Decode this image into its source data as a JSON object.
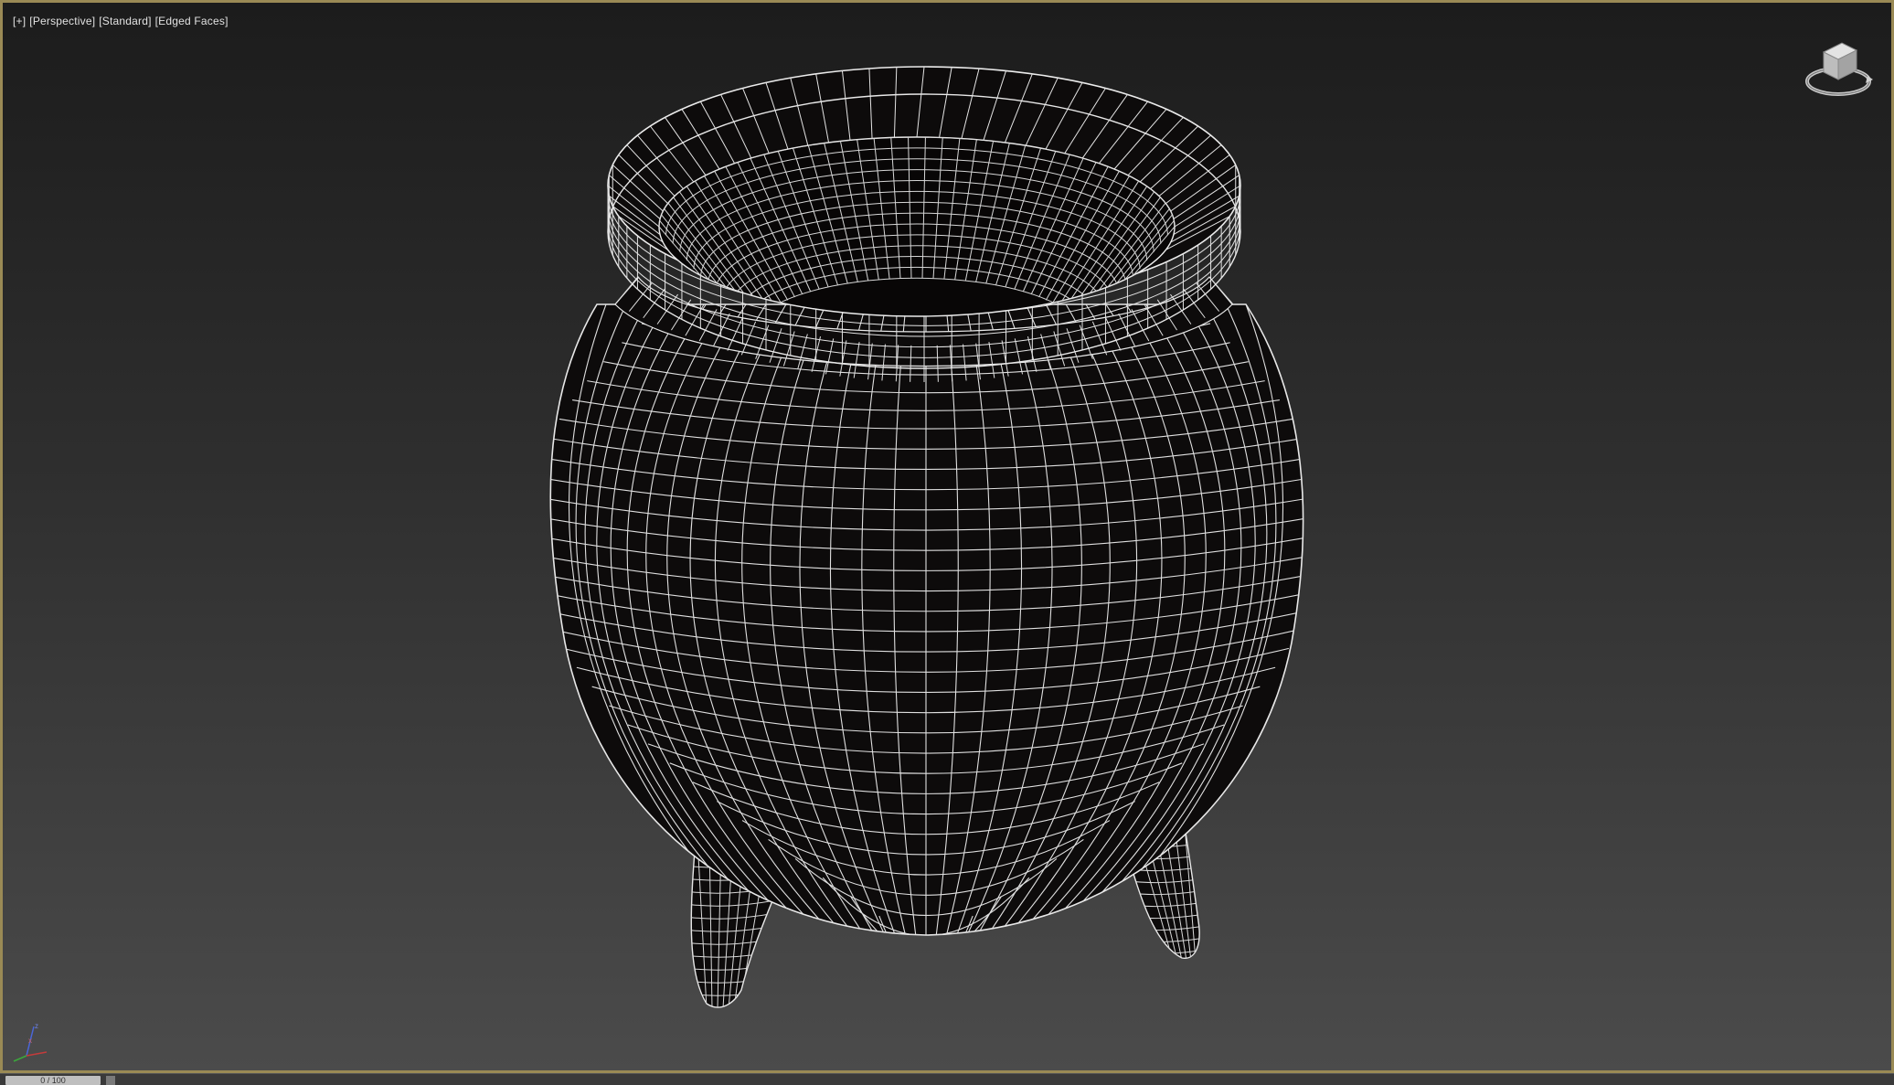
{
  "viewport": {
    "labels": [
      "[+]",
      "[Perspective]",
      "[Standard]",
      "[Edged Faces]"
    ]
  },
  "timeline": {
    "frame_text": "0 / 100"
  },
  "colors": {
    "border": "#9a8a55",
    "wire": "#e8e8e8",
    "mesh_fill": "#0d0b0b"
  },
  "icons": {
    "viewcube": "viewcube-icon",
    "axis": "axis-tripod-icon"
  }
}
